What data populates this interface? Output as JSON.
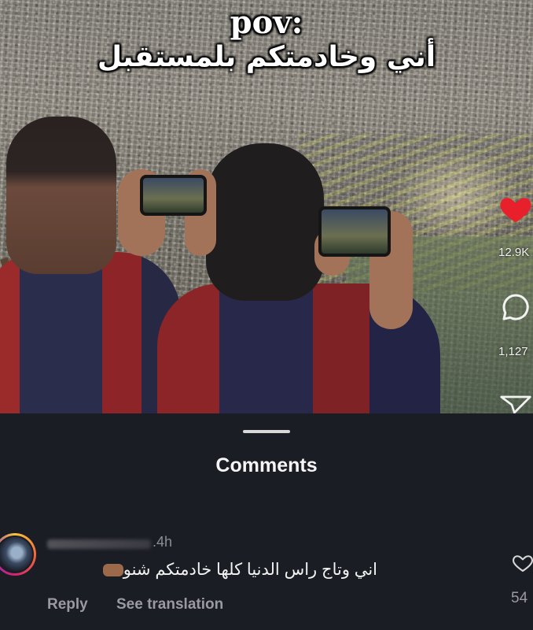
{
  "video": {
    "overlay_line1": "pov:",
    "overlay_line2": "أني وخادمتكم بلمستقبل"
  },
  "actions": {
    "likes": "12.9K",
    "comments": "1,127",
    "like_color": "#e8202c"
  },
  "comments_sheet": {
    "title": "Comments",
    "comment": {
      "time": ".4h",
      "text": "اني وتاج راس الدنيا كلها خادمتكم شنو",
      "reply_label": "Reply",
      "translate_label": "See translation",
      "likes": "54"
    }
  }
}
